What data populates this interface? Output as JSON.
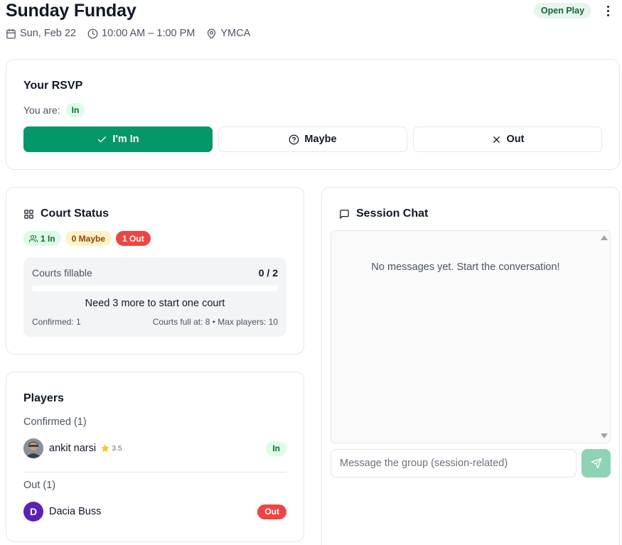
{
  "header": {
    "title": "Sunday Funday",
    "date": "Sun, Feb 22",
    "time": "10:00 AM – 1:00 PM",
    "location": "YMCA",
    "badge": "Open Play"
  },
  "rsvp": {
    "title": "Your RSVP",
    "status_label": "You are:",
    "status_value": "In",
    "buttons": {
      "in": "I'm In",
      "maybe": "Maybe",
      "out": "Out"
    }
  },
  "court_status": {
    "title": "Court Status",
    "counts": {
      "in": "1 In",
      "maybe": "0 Maybe",
      "out": "1 Out"
    },
    "fillable_label": "Courts fillable",
    "fillable_value": "0 / 2",
    "fill_fraction": 0,
    "message": "Need 3 more to start one court",
    "confirmed": "Confirmed: 1",
    "courts_info": "Courts full at: 8 • Max players: 10"
  },
  "players": {
    "title": "Players",
    "confirmed_heading": "Confirmed (1)",
    "out_heading": "Out (1)",
    "confirmed": [
      {
        "name": "ankit narsi",
        "rating": "3.5",
        "status": "In"
      }
    ],
    "out": [
      {
        "initial": "D",
        "name": "Dacia Buss",
        "status": "Out"
      }
    ]
  },
  "chat": {
    "title": "Session Chat",
    "empty_message": "No messages yet. Start the conversation!",
    "input_placeholder": "Message the group (session-related)"
  },
  "colors": {
    "primary": "#059669",
    "in_badge_bg": "#dcfce7",
    "maybe_badge_bg": "#fef3c7",
    "out_badge": "#ef4444",
    "avatar_purple": "#5b21b6"
  }
}
